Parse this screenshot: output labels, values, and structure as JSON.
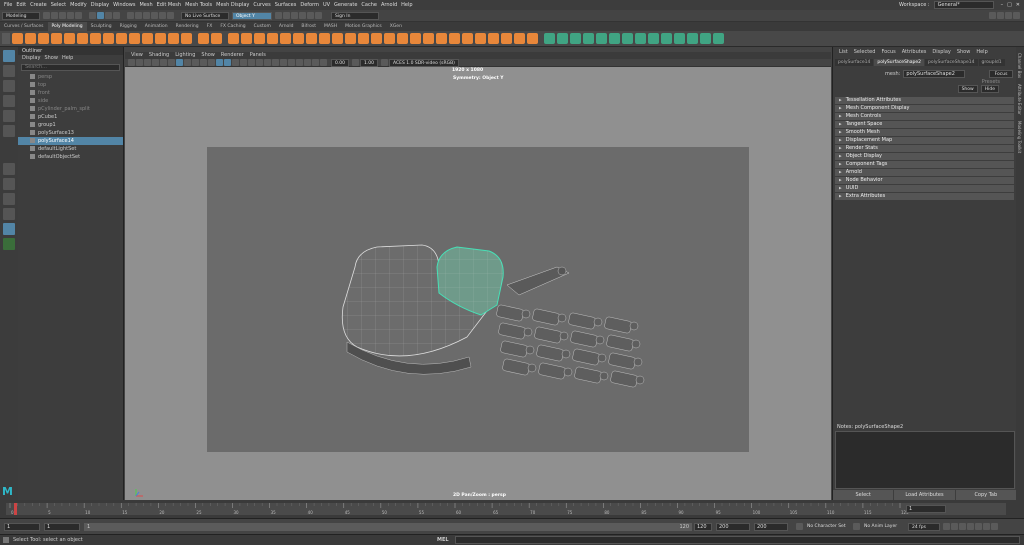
{
  "menubar": {
    "items": [
      "File",
      "Edit",
      "Create",
      "Select",
      "Modify",
      "Display",
      "Windows",
      "Mesh",
      "Edit Mesh",
      "Mesh Tools",
      "Mesh Display",
      "Curves",
      "Surfaces",
      "Deform",
      "UV",
      "Generate",
      "Cache",
      "Arnold",
      "Help"
    ],
    "workspace_label": "Workspace :",
    "workspace_value": "General*"
  },
  "statusline": {
    "mode": "Modeling",
    "live_surface": "No Live Surface",
    "symmetry": "Object Y",
    "sign_in": "Sign In"
  },
  "shelf": {
    "tabs": [
      "Curves / Surfaces",
      "Poly Modeling",
      "Sculpting",
      "Rigging",
      "Animation",
      "Rendering",
      "FX",
      "FX Caching",
      "Custom",
      "Arnold",
      "Bifrost",
      "MASH",
      "Motion Graphics",
      "XGen"
    ],
    "active_tab": "Poly Modeling",
    "accent_color": "#e8873a",
    "tool_color": "#3fae8a"
  },
  "outliner": {
    "title": "Outliner",
    "menu": [
      "Display",
      "Show",
      "Help"
    ],
    "search_placeholder": "Search...",
    "items": [
      {
        "label": "persp",
        "dim": true
      },
      {
        "label": "top",
        "dim": true
      },
      {
        "label": "front",
        "dim": true
      },
      {
        "label": "side",
        "dim": true
      },
      {
        "label": "pCylinder_palm_split",
        "dim": true
      },
      {
        "label": "pCube1",
        "dim": false
      },
      {
        "label": "group1",
        "dim": false
      },
      {
        "label": "polySurface13",
        "dim": false
      },
      {
        "label": "polySurface14",
        "dim": false,
        "selected": true
      },
      {
        "label": "defaultLightSet",
        "dim": false
      },
      {
        "label": "defaultObjectSet",
        "dim": false
      }
    ]
  },
  "viewport": {
    "menu": [
      "View",
      "Shading",
      "Lighting",
      "Show",
      "Renderer",
      "Panels"
    ],
    "value_a": "0.00",
    "value_b": "1.00",
    "color_space": "ACES 1.0 SDR-video (sRGB)",
    "resolution": "1920 x 1080",
    "symmetry_label": "Symmetry: Object Y",
    "camera_label": "2D Pan/Zoom : persp"
  },
  "attribute_editor": {
    "menu": [
      "List",
      "Selected",
      "Focus",
      "Attributes",
      "Display",
      "Show",
      "Help"
    ],
    "tabs": [
      "polySurface14",
      "polySurfaceShape2",
      "polySurfaceShape14",
      "groupId1"
    ],
    "active_tab": "polySurfaceShape2",
    "mesh_label": "mesh:",
    "mesh_value": "polySurfaceShape2",
    "focus_label": "Focus",
    "presets_label": "Presets",
    "show_label": "Show",
    "hide_label": "Hide",
    "sections": [
      "Tessellation Attributes",
      "Mesh Component Display",
      "Mesh Controls",
      "Tangent Space",
      "Smooth Mesh",
      "Displacement Map",
      "Render Stats",
      "Object Display",
      "Component Tags",
      "Arnold",
      "Node Behavior",
      "UUID",
      "Extra Attributes"
    ],
    "notes": "Notes: polySurfaceShape2",
    "buttons": [
      "Select",
      "Load Attributes",
      "Copy Tab"
    ]
  },
  "right_strip": [
    "Channel Box",
    "Attribute Editor",
    "Modeling Toolkit"
  ],
  "timeline": {
    "ticks": [
      "0",
      "5",
      "10",
      "15",
      "20",
      "25",
      "30",
      "35",
      "40",
      "45",
      "50",
      "55",
      "60",
      "65",
      "70",
      "75",
      "80",
      "85",
      "90",
      "95",
      "100",
      "105",
      "110",
      "115",
      "120"
    ],
    "current_frame": "1"
  },
  "range": {
    "start_a": "1",
    "start_b": "1",
    "slider_start": "1",
    "slider_end": "120",
    "end_a": "120",
    "end_b": "200",
    "end_c": "200",
    "character_set": "No Character Set",
    "anim_layer": "No Anim Layer",
    "fps": "24 fps"
  },
  "helpline": {
    "message": "Select Tool: select an object",
    "mel_label": "MEL"
  }
}
